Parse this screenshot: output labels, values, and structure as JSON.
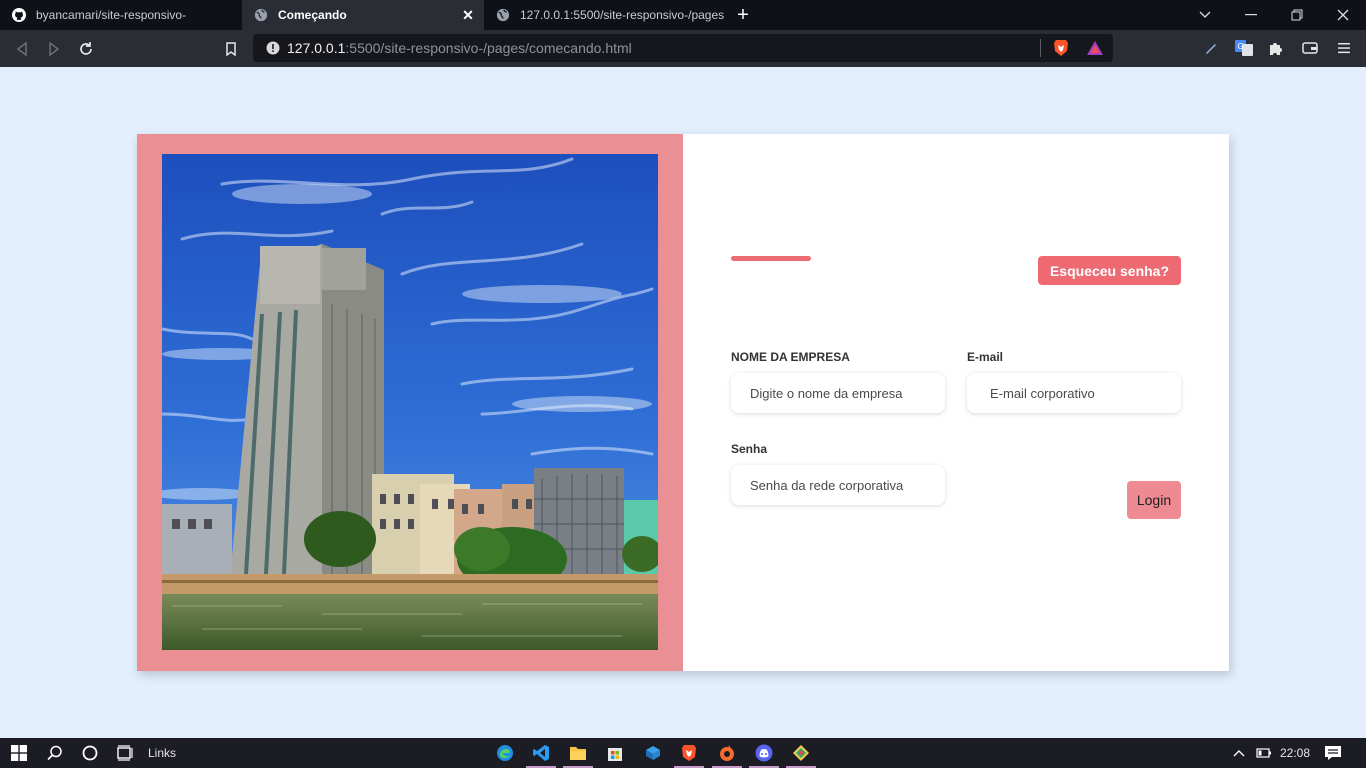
{
  "browser": {
    "tabs": [
      {
        "title": "byancamari/site-responsivo-",
        "active": false,
        "icon": "github-icon"
      },
      {
        "title": "Começando",
        "active": true,
        "icon": "globe-icon"
      },
      {
        "title": "127.0.0.1:5500/site-responsivo-/pages",
        "active": false,
        "icon": "globe-icon"
      }
    ],
    "url_host": "127.0.0.1",
    "url_rest": ":5500/site-responsivo-/pages/comecando.html"
  },
  "page": {
    "forgot_label": "Esqueceu senha?",
    "company_label": "NOME DA EMPRESA",
    "company_placeholder": "Digite o nome da empresa",
    "email_label": "E-mail",
    "email_placeholder": "E-mail corporativo",
    "password_label": "Senha",
    "password_placeholder": "Senha da rede corporativa",
    "login_label": "Login"
  },
  "taskbar": {
    "links_label": "Links",
    "time": "22:08"
  },
  "colors": {
    "page_bg": "#e3effd",
    "frame": "#ea8f94",
    "accent": "#ea6b72",
    "forgot_button": "#ee6a72",
    "login_button": "#ee8a91"
  }
}
